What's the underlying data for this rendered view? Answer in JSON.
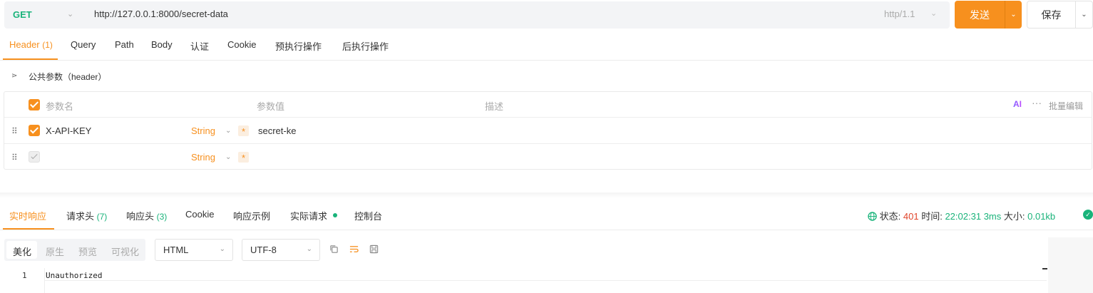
{
  "request": {
    "method": "GET",
    "url": "http://127.0.0.1:8000/secret-data",
    "http_version": "http/1.1",
    "send_label": "发送",
    "save_label": "保存"
  },
  "request_tabs": [
    {
      "label": "Header",
      "count": "(1)",
      "active": true
    },
    {
      "label": "Query"
    },
    {
      "label": "Path"
    },
    {
      "label": "Body"
    },
    {
      "label": "认证"
    },
    {
      "label": "Cookie"
    },
    {
      "label": "预执行操作"
    },
    {
      "label": "后执行操作"
    }
  ],
  "public_params": {
    "label": "公共参数（header）"
  },
  "params_table": {
    "headers": {
      "name": "参数名",
      "value": "参数值",
      "desc": "描述"
    },
    "ai_label": "AI",
    "more_label": "···",
    "bulk_edit": "批量编辑",
    "rows": [
      {
        "checked": true,
        "name": "X-API-KEY",
        "type": "String",
        "required_mark": "*",
        "value": "secret-ke"
      },
      {
        "checked": false,
        "name": "",
        "type": "String",
        "required_mark": "*",
        "value": ""
      }
    ]
  },
  "response_tabs": [
    {
      "label": "实时响应",
      "active": true
    },
    {
      "label": "请求头",
      "count": "(7)"
    },
    {
      "label": "响应头",
      "count": "(3)"
    },
    {
      "label": "Cookie"
    },
    {
      "label": "响应示例"
    },
    {
      "label": "实际请求"
    },
    {
      "label": "控制台"
    }
  ],
  "response_status": {
    "status_label": "状态:",
    "status_value": "401",
    "time_label": "时间:",
    "time_value": "22:02:31",
    "duration": "3ms",
    "size_label": "大小:",
    "size_value": "0.01kb"
  },
  "view_modes": [
    "美化",
    "原生",
    "预览",
    "可视化"
  ],
  "format_select": "HTML",
  "encoding_select": "UTF-8",
  "response_body": {
    "line_number": "1",
    "text": "Unauthorized"
  },
  "colors": {
    "accent": "#f7901e",
    "success": "#19b37a",
    "error": "#e0452b"
  }
}
